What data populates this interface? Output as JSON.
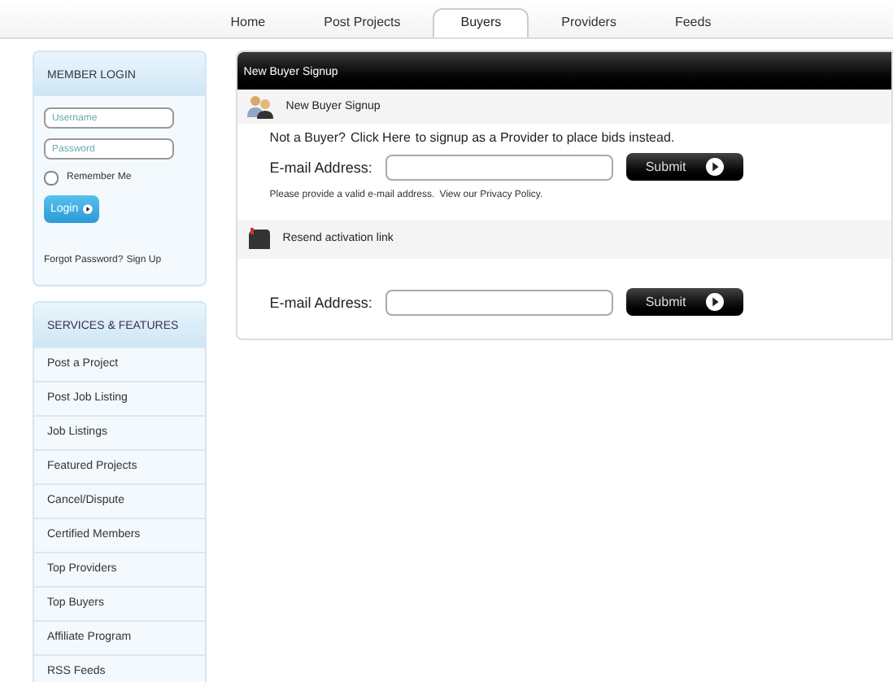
{
  "nav": {
    "tabs": [
      {
        "label": "Home",
        "selected": false
      },
      {
        "label": "Post Projects",
        "selected": false
      },
      {
        "label": "Buyers",
        "selected": true
      },
      {
        "label": "Providers",
        "selected": false
      },
      {
        "label": "Feeds",
        "selected": false
      }
    ]
  },
  "login": {
    "title": "MEMBER LOGIN",
    "username": {
      "placeholder": "Username"
    },
    "password": {
      "placeholder": "Password"
    },
    "remember": {
      "label": "Remember Me",
      "checked": false
    },
    "button": "Login",
    "links": [
      "Forgot Password?",
      "Sign Up"
    ]
  },
  "services": {
    "title": "SERVICES & FEATURES",
    "items": [
      "Post a Project",
      "Post Job Listing",
      "Job Listings",
      "Featured Projects",
      "Cancel/Dispute",
      "Certified Members",
      "Top Providers",
      "Top Buyers",
      "Affiliate Program",
      "RSS Feeds"
    ]
  },
  "panel": {
    "title": "New Buyer Signup",
    "signup": {
      "heading": "New Buyer Signup",
      "notice_before": "Not a Buyer?",
      "notice_link": "Click Here",
      "notice_after": "to signup as a Provider to place bids instead.",
      "email_label": "E-mail Address:",
      "button": "Submit",
      "hint": "Please provide a valid e-mail address.",
      "hint_link": "View our Privacy Policy."
    },
    "resend": {
      "heading": "Resend activation link",
      "email_label": "E-mail Address:",
      "button": "Submit"
    }
  }
}
